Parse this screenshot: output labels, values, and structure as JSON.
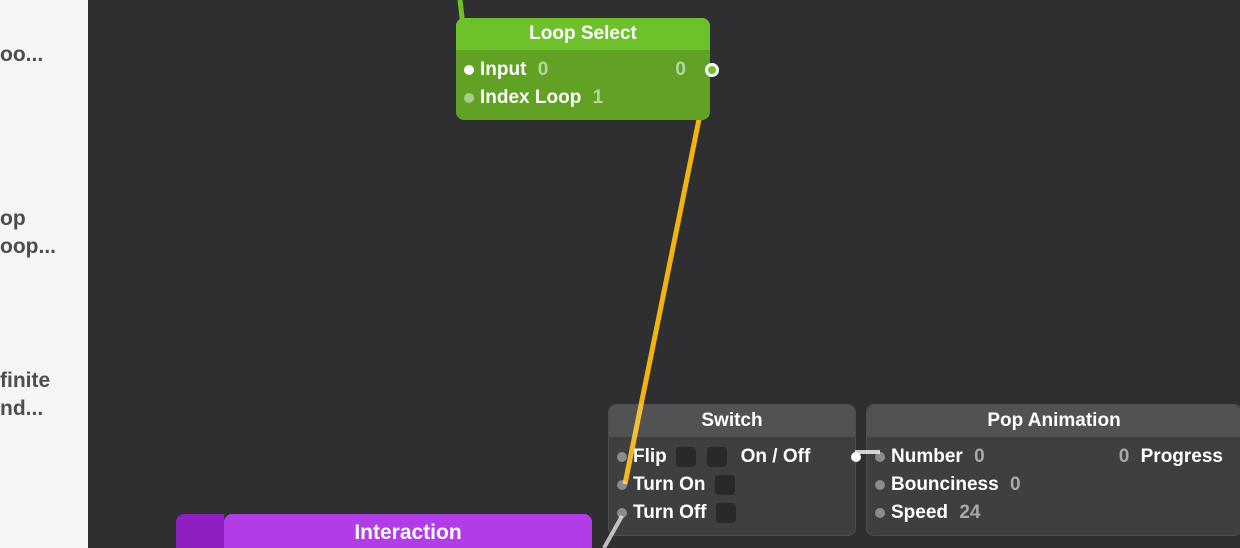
{
  "sidebar": {
    "i0": "oo...",
    "i1": "op",
    "i2": "oop...",
    "i3": "finite",
    "i4": "nd..."
  },
  "loopSelect": {
    "title": "Loop Select",
    "input_label": "Input",
    "input_value": "0",
    "index_label": "Index Loop",
    "index_value": "1",
    "out_value": "0"
  },
  "switch": {
    "title": "Switch",
    "flip": "Flip",
    "onoff": "On / Off",
    "turnon": "Turn On",
    "turnoff": "Turn Off"
  },
  "pop": {
    "title": "Pop Animation",
    "number": "Number",
    "number_v": "0",
    "bounciness": "Bounciness",
    "bounciness_v": "0",
    "speed": "Speed",
    "speed_v": "24",
    "progress": "Progress",
    "progress_v": "0"
  },
  "interaction": {
    "title": "Interaction"
  }
}
